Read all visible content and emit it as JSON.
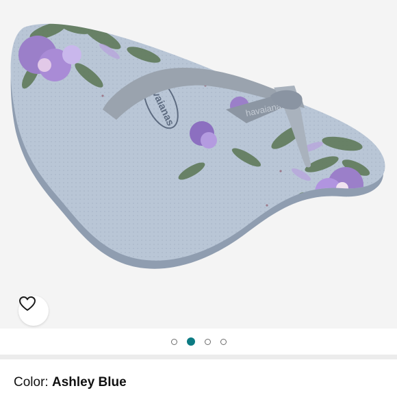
{
  "product": {
    "image_alt": "Havaianas Slim flip flop, floral print",
    "brand_print": "havaianas",
    "color_label": "Color: ",
    "color_value": "Ashley Blue"
  },
  "carousel": {
    "total": 4,
    "active_index": 1
  },
  "icons": {
    "wishlist": "heart-outline-icon"
  },
  "colors": {
    "background": "#f4f4f4",
    "sole": "#b6c3d2",
    "strap": "#9aa3ae",
    "flower_purple": "#9b7fc9",
    "leaf_green": "#5f7a5a",
    "active_dot": "#0c7b83"
  }
}
